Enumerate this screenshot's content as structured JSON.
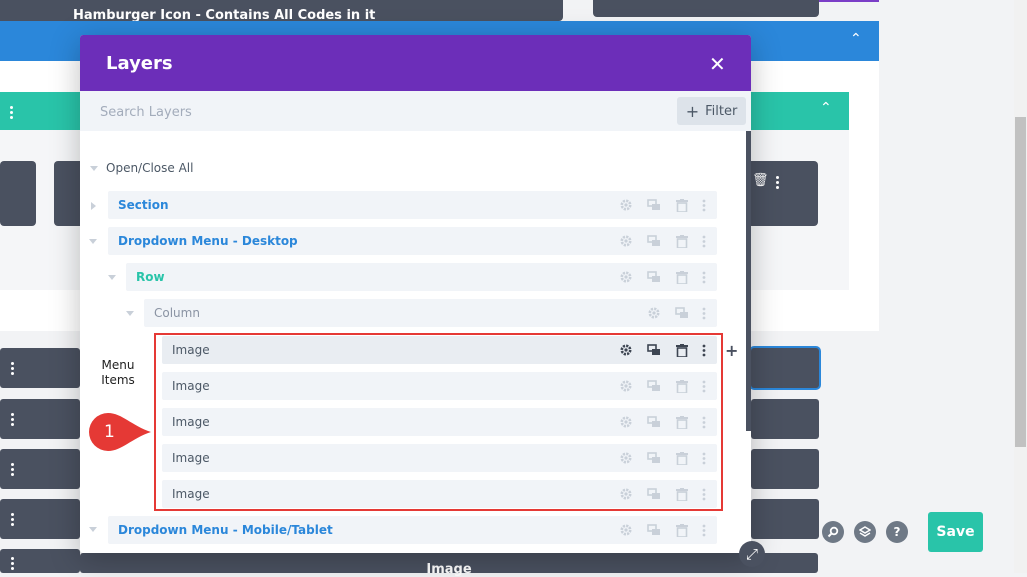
{
  "background": {
    "top_module_text": "Hamburger Icon - Contains All Codes in it",
    "bottom_module_text": "Image"
  },
  "modal": {
    "title": "Layers",
    "search_placeholder": "Search Layers",
    "filter_label": "Filter",
    "open_close_label": "Open/Close All"
  },
  "layers": {
    "section": "Section",
    "dropdown_desktop": "Dropdown Menu - Desktop",
    "row": "Row",
    "column": "Column",
    "images": [
      "Image",
      "Image",
      "Image",
      "Image",
      "Image"
    ],
    "dropdown_mobile": "Dropdown Menu - Mobile/Tablet"
  },
  "annotation": {
    "menu_items_label": "Menu Items",
    "callout_number": "1"
  },
  "footer": {
    "save_label": "Save"
  },
  "colors": {
    "modal_header": "#6c2eb9",
    "section": "#2b87da",
    "row": "#29c4a9",
    "highlight": "#e53935",
    "save": "#29c4a9"
  }
}
